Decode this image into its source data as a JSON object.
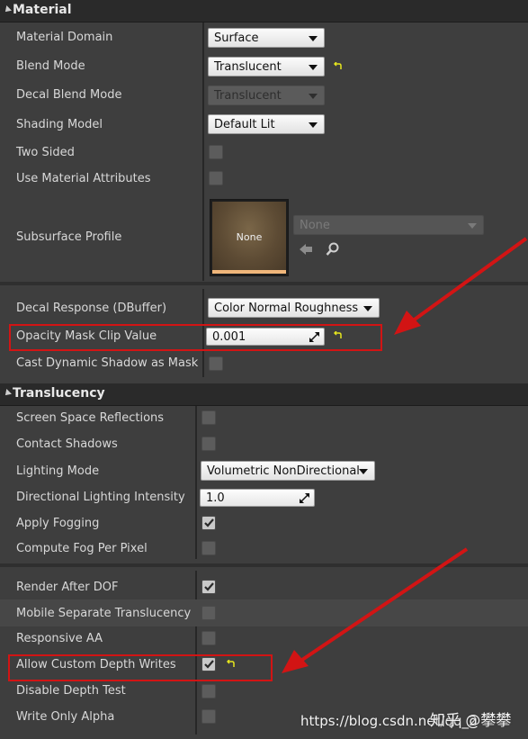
{
  "material": {
    "title": "Material",
    "material_domain": {
      "label": "Material Domain",
      "value": "Surface"
    },
    "blend_mode": {
      "label": "Blend Mode",
      "value": "Translucent"
    },
    "decal_blend_mode": {
      "label": "Decal Blend Mode",
      "value": "Translucent"
    },
    "shading_model": {
      "label": "Shading Model",
      "value": "Default Lit"
    },
    "two_sided": {
      "label": "Two Sided",
      "checked": false
    },
    "use_material_attributes": {
      "label": "Use Material Attributes",
      "checked": false
    },
    "subsurface_profile": {
      "label": "Subsurface Profile",
      "thumbnail": "None",
      "asset": "None"
    },
    "decal_response": {
      "label": "Decal Response (DBuffer)",
      "value": "Color Normal Roughness"
    },
    "opacity_mask_clip_value": {
      "label": "Opacity Mask Clip Value",
      "value": "0.001"
    },
    "cast_dynamic_shadow_as_masked": {
      "label": "Cast Dynamic Shadow as Mask",
      "checked": false
    }
  },
  "translucency": {
    "title": "Translucency",
    "screen_space_reflections": {
      "label": "Screen Space Reflections",
      "checked": false
    },
    "contact_shadows": {
      "label": "Contact Shadows",
      "checked": false
    },
    "lighting_mode": {
      "label": "Lighting Mode",
      "value": "Volumetric NonDirectional"
    },
    "directional_lighting_intensity": {
      "label": "Directional Lighting Intensity",
      "value": "1.0"
    },
    "apply_fogging": {
      "label": "Apply Fogging",
      "checked": true
    },
    "compute_fog_per_pixel": {
      "label": "Compute Fog Per Pixel",
      "checked": false
    },
    "render_after_dof": {
      "label": "Render After DOF",
      "checked": true
    },
    "mobile_separate_translucency": {
      "label": "Mobile Separate Translucency",
      "checked": false
    },
    "responsive_aa": {
      "label": "Responsive AA",
      "checked": false
    },
    "allow_custom_depth_writes": {
      "label": "Allow Custom Depth Writes",
      "checked": true
    },
    "disable_depth_test": {
      "label": "Disable Depth Test",
      "checked": false
    },
    "write_only_alpha": {
      "label": "Write Only Alpha",
      "checked": false
    }
  },
  "colors": {
    "annotation_red": "#d21414",
    "reset_arrow_yellow": "#e6e61e"
  },
  "watermark": {
    "text": "https://blog.csdn.net/qq_2",
    "zhihu": "知乎 @攀攀"
  }
}
